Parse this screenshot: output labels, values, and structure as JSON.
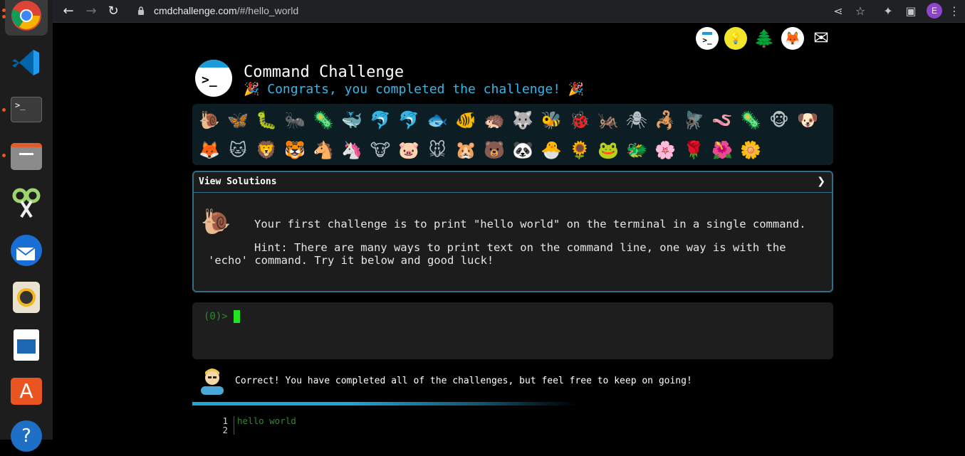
{
  "browser": {
    "url_domain": "cmdchallenge.com",
    "url_path": "/#/hello_world",
    "avatar_letter": "E",
    "back_icon": "back-arrow-icon",
    "forward_icon": "forward-arrow-icon",
    "reload_icon": "reload-icon"
  },
  "dock": {
    "apps": [
      "Chrome",
      "Visual Studio Code",
      "Terminal",
      "Files",
      "Screenshot",
      "Thunderbird",
      "Rhythmbox",
      "LibreOffice Writer",
      "Ubuntu Software",
      "Help"
    ]
  },
  "header": {
    "title": "Command Challenge",
    "subtitle": "🎉 Congrats, you completed the challenge! 🎉",
    "logo_prompt": ">_"
  },
  "social_icons": [
    "terminal-icon",
    "bulb-icon",
    "tree-icon",
    "gitlab-icon",
    "mail-icon"
  ],
  "animals": {
    "row1": [
      "🐌",
      "🦋",
      "🐛",
      "🐜",
      "🦠",
      "🐳",
      "🐬",
      "🐬",
      "🐟",
      "🐠",
      "🦔",
      "🐺",
      "🐝",
      "🐞",
      "🦗",
      "🕷",
      "🦂",
      "🪰",
      "🪱",
      "🦠",
      "🐵",
      "🐶"
    ],
    "row2": [
      "🦊",
      "🐱",
      "🦁",
      "🐯",
      "🐴",
      "🦄",
      "🐮",
      "🐷",
      "🐭",
      "🐹",
      "🐻",
      "🐼",
      "🐣",
      "🌻",
      "🐸",
      "🐲",
      "🌸",
      "🌹",
      "🌺",
      "🌼"
    ]
  },
  "solutions": {
    "header": "View Solutions",
    "chevron": "❯",
    "challenge": "Your first challenge is to print \"hello world\" on the terminal in a single command.",
    "hint": "Hint: There are many ways to print text on the command line, one way is with the 'echo' command. Try it below and good luck!"
  },
  "terminal": {
    "prompt": "(0)>"
  },
  "result": {
    "message": "Correct! You have completed all of the challenges, but feel free to keep on going!"
  },
  "output": {
    "lines": [
      {
        "num": "1",
        "text": "hello world"
      },
      {
        "num": "2",
        "text": ""
      }
    ]
  }
}
